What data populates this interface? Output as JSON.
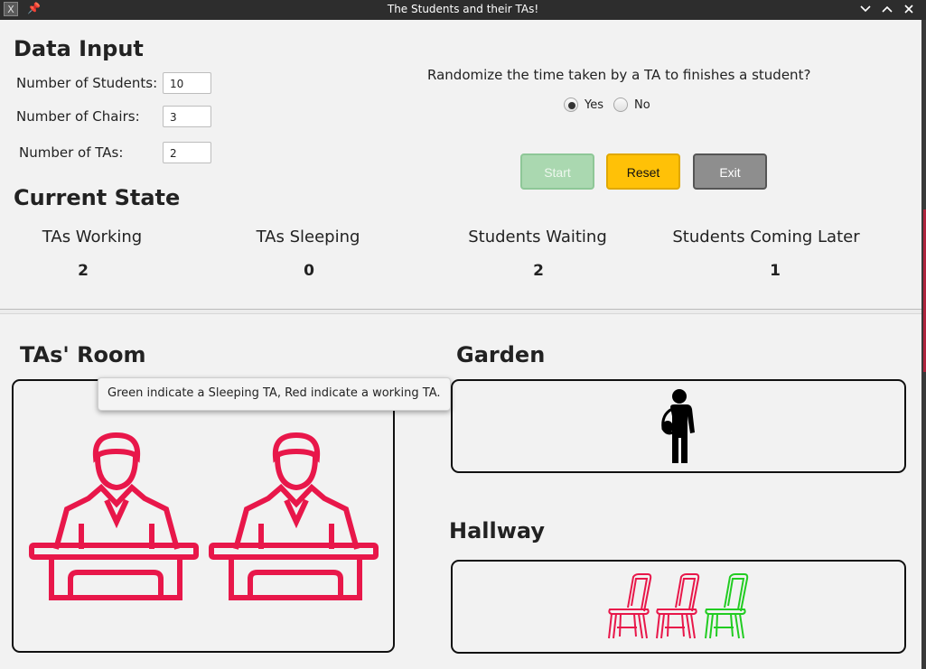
{
  "window": {
    "title": "The Students and their TAs!",
    "app_icon_glyph": "X",
    "pin_glyph": "📌"
  },
  "data_input": {
    "heading": "Data Input",
    "students_label": "Number of Students:",
    "students_value": "10",
    "chairs_label": "Number of Chairs:",
    "chairs_value": "3",
    "tas_label": "Number of TAs:",
    "tas_value": "2"
  },
  "randomize": {
    "question": "Randomize the time taken by a TA to finishes a student?",
    "yes_label": "Yes",
    "no_label": "No",
    "selected": "Yes"
  },
  "buttons": {
    "start": "Start",
    "reset": "Reset",
    "exit": "Exit"
  },
  "current_state": {
    "heading": "Current State",
    "stats": [
      {
        "label": "TAs Working",
        "value": "2"
      },
      {
        "label": "TAs Sleeping",
        "value": "0"
      },
      {
        "label": "Students Waiting",
        "value": "2"
      },
      {
        "label": "Students Coming Later",
        "value": "1"
      }
    ]
  },
  "tas_room": {
    "heading": "TAs' Room",
    "tooltip": "Green indicate a Sleeping TA, Red indicate a working TA."
  },
  "garden": {
    "heading": "Garden"
  },
  "hallway": {
    "heading": "Hallway"
  },
  "colors": {
    "working": "#e8174a",
    "sleeping": "#22cc22",
    "student": "#000000"
  }
}
